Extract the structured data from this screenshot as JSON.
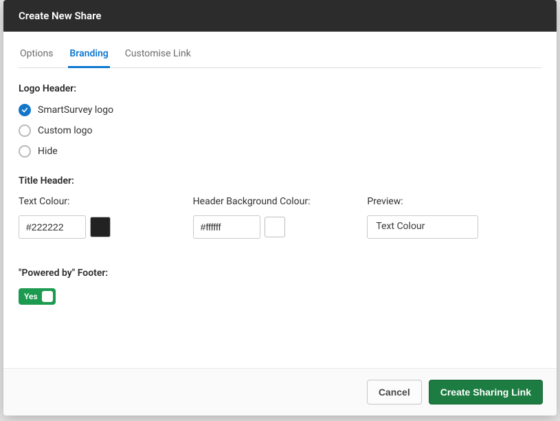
{
  "modal": {
    "title": "Create New Share"
  },
  "tabs": {
    "options": "Options",
    "branding": "Branding",
    "customise": "Customise Link"
  },
  "logoHeader": {
    "label": "Logo Header:",
    "options": {
      "smartsurvey": "SmartSurvey logo",
      "custom": "Custom logo",
      "hide": "Hide"
    }
  },
  "titleHeader": {
    "label": "Title Header:",
    "textColour": {
      "label": "Text Colour:",
      "value": "#222222",
      "swatch": "#222222"
    },
    "bgColour": {
      "label": "Header Background Colour:",
      "value": "#ffffff",
      "swatch": "#ffffff"
    },
    "preview": {
      "label": "Preview:",
      "text": "Text Colour"
    }
  },
  "poweredBy": {
    "label": "\"Powered by\" Footer:",
    "toggleText": "Yes"
  },
  "footer": {
    "cancel": "Cancel",
    "create": "Create Sharing Link"
  }
}
